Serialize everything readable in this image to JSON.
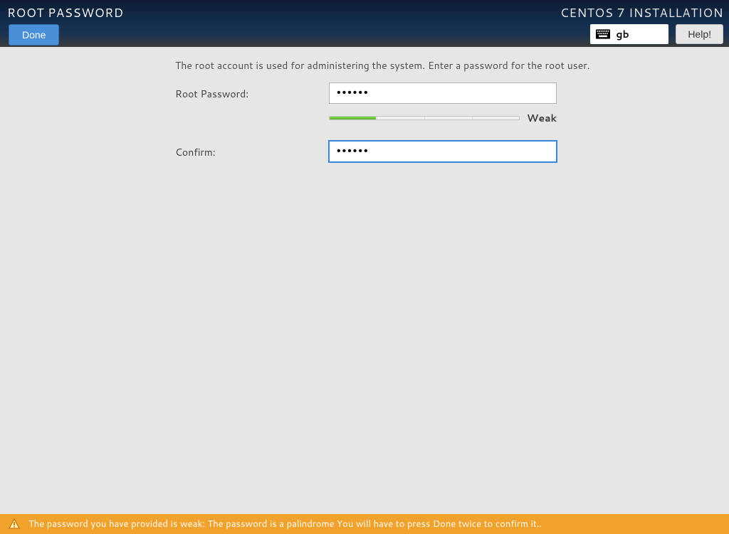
{
  "header": {
    "title": "ROOT PASSWORD",
    "done_label": "Done",
    "installer_title": "CENTOS 7 INSTALLATION",
    "keyboard_layout": "gb",
    "help_label": "Help!"
  },
  "main": {
    "instructions": "The root account is used for administering the system.  Enter a password for the root user.",
    "root_password_label": "Root Password:",
    "root_password_value": "••••••",
    "confirm_label": "Confirm:",
    "confirm_value": "••••••",
    "strength_label": "Weak"
  },
  "warning": {
    "text": "The password you have provided is weak: The password is a palindrome You will have to press Done twice to confirm it.."
  }
}
